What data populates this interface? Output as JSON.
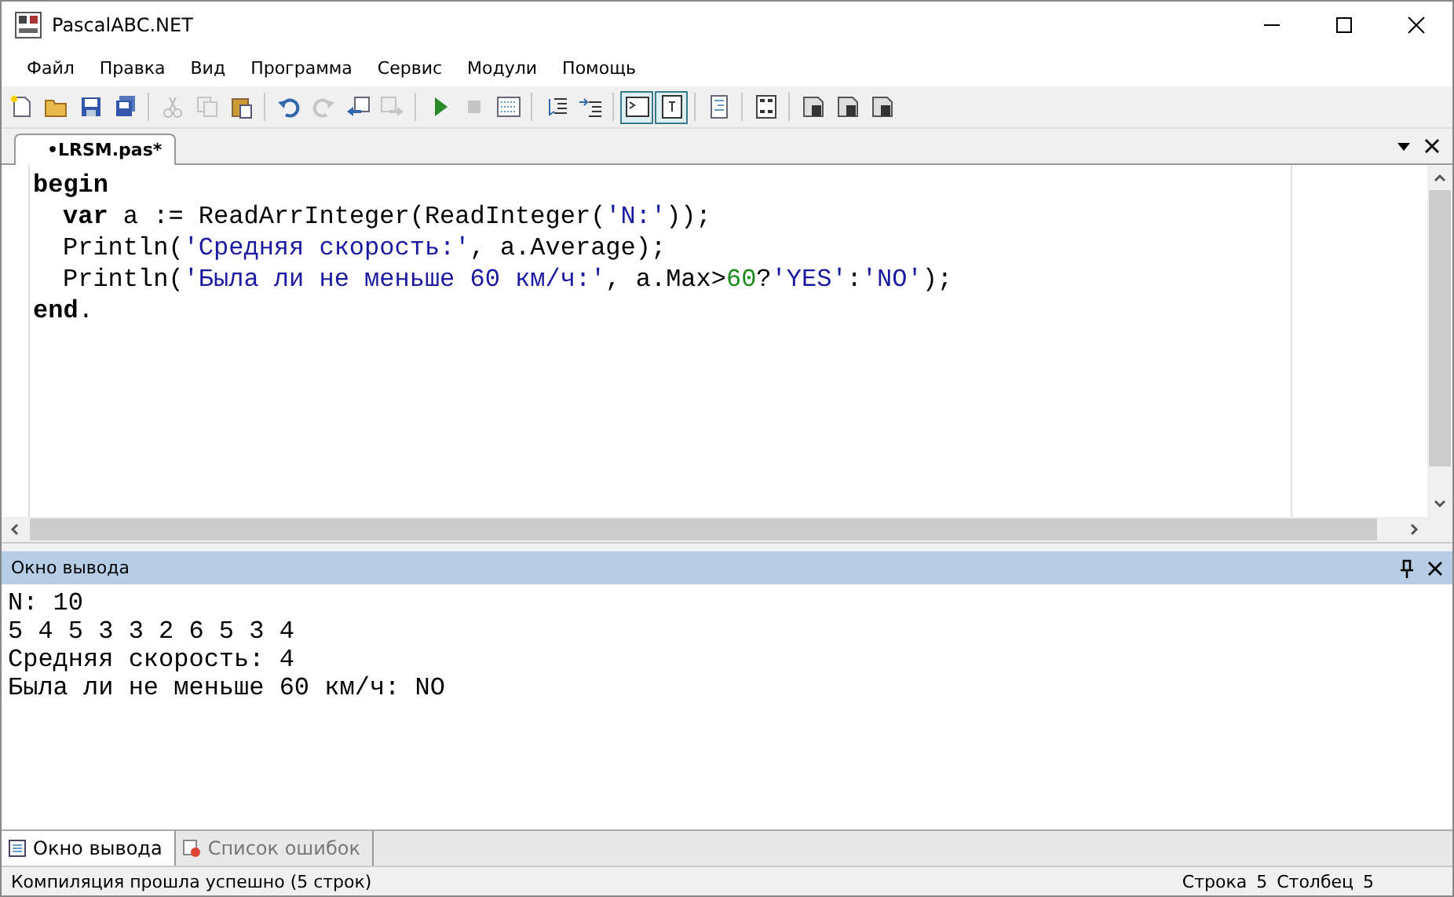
{
  "window": {
    "title": "PascalABC.NET"
  },
  "menu": [
    "Файл",
    "Правка",
    "Вид",
    "Программа",
    "Сервис",
    "Модули",
    "Помощь"
  ],
  "toolbar": [
    {
      "kind": "new",
      "disabled": false,
      "selected": false
    },
    {
      "kind": "open",
      "disabled": false,
      "selected": false
    },
    {
      "kind": "save",
      "disabled": false,
      "selected": false
    },
    {
      "kind": "saveall",
      "disabled": false,
      "selected": false
    },
    {
      "kind": "sep"
    },
    {
      "kind": "cut",
      "disabled": true,
      "selected": false
    },
    {
      "kind": "copy",
      "disabled": true,
      "selected": false
    },
    {
      "kind": "paste",
      "disabled": false,
      "selected": false
    },
    {
      "kind": "sep"
    },
    {
      "kind": "undo",
      "disabled": false,
      "selected": false
    },
    {
      "kind": "redo",
      "disabled": true,
      "selected": false
    },
    {
      "kind": "back",
      "disabled": false,
      "selected": false
    },
    {
      "kind": "forward",
      "disabled": true,
      "selected": false
    },
    {
      "kind": "sep"
    },
    {
      "kind": "run",
      "disabled": false,
      "selected": false
    },
    {
      "kind": "stop",
      "disabled": true,
      "selected": false
    },
    {
      "kind": "compile",
      "disabled": false,
      "selected": false
    },
    {
      "kind": "sep"
    },
    {
      "kind": "indent",
      "disabled": false,
      "selected": false
    },
    {
      "kind": "outdent",
      "disabled": false,
      "selected": false
    },
    {
      "kind": "sep"
    },
    {
      "kind": "console",
      "disabled": false,
      "selected": true
    },
    {
      "kind": "textwin",
      "disabled": false,
      "selected": true
    },
    {
      "kind": "sep"
    },
    {
      "kind": "doc",
      "disabled": false,
      "selected": false
    },
    {
      "kind": "sep"
    },
    {
      "kind": "codeform",
      "disabled": false,
      "selected": false
    },
    {
      "kind": "sep"
    },
    {
      "kind": "page",
      "disabled": false,
      "selected": false
    },
    {
      "kind": "page",
      "disabled": false,
      "selected": false
    },
    {
      "kind": "page",
      "disabled": false,
      "selected": false
    }
  ],
  "editor_tabs": [
    {
      "label": "•LRSM.pas*",
      "selected": true
    }
  ],
  "code": [
    {
      "indented": false,
      "tokens": [
        {
          "kind": "keyword",
          "text": "begin"
        }
      ]
    },
    {
      "indented": true,
      "tokens": [
        {
          "kind": "keyword",
          "text": "var"
        },
        {
          "kind": "plain",
          "text": " a := ReadArrInteger(ReadInteger("
        },
        {
          "kind": "string",
          "text": "'N:'"
        },
        {
          "kind": "plain",
          "text": "));"
        }
      ]
    },
    {
      "indented": true,
      "tokens": [
        {
          "kind": "plain",
          "text": "Println("
        },
        {
          "kind": "string",
          "text": "'Средняя скорость:'"
        },
        {
          "kind": "plain",
          "text": ", a.Average);"
        }
      ]
    },
    {
      "indented": true,
      "tokens": [
        {
          "kind": "plain",
          "text": "Println("
        },
        {
          "kind": "string",
          "text": "'Была ли не меньше 60 км/ч:'"
        },
        {
          "kind": "plain",
          "text": ", a.Max>"
        },
        {
          "kind": "number",
          "text": "60"
        },
        {
          "kind": "plain",
          "text": "?"
        },
        {
          "kind": "string",
          "text": "'YES'"
        },
        {
          "kind": "plain",
          "text": ":"
        },
        {
          "kind": "string",
          "text": "'NO'"
        },
        {
          "kind": "plain",
          "text": ");"
        }
      ]
    },
    {
      "indented": false,
      "tokens": [
        {
          "kind": "keyword",
          "text": "end"
        },
        {
          "kind": "plain",
          "text": "."
        }
      ]
    }
  ],
  "output_panel": {
    "title": "Окно вывода",
    "lines": [
      "N: 10",
      "5 4 5 3 3 2 6 5 3 4",
      "Средняя скорость: 4",
      "Была ли не меньше 60 км/ч: NO"
    ]
  },
  "bottom_tabs": [
    {
      "label": "Окно вывода",
      "kind": "output",
      "selected": true
    },
    {
      "label": "Список ошибок",
      "kind": "errors",
      "selected": false
    }
  ],
  "status_bar": {
    "message": "Компиляция прошла успешно (5 строк)",
    "row_label": "Строка",
    "row": "5",
    "col_label": "Столбец",
    "col": "5"
  }
}
